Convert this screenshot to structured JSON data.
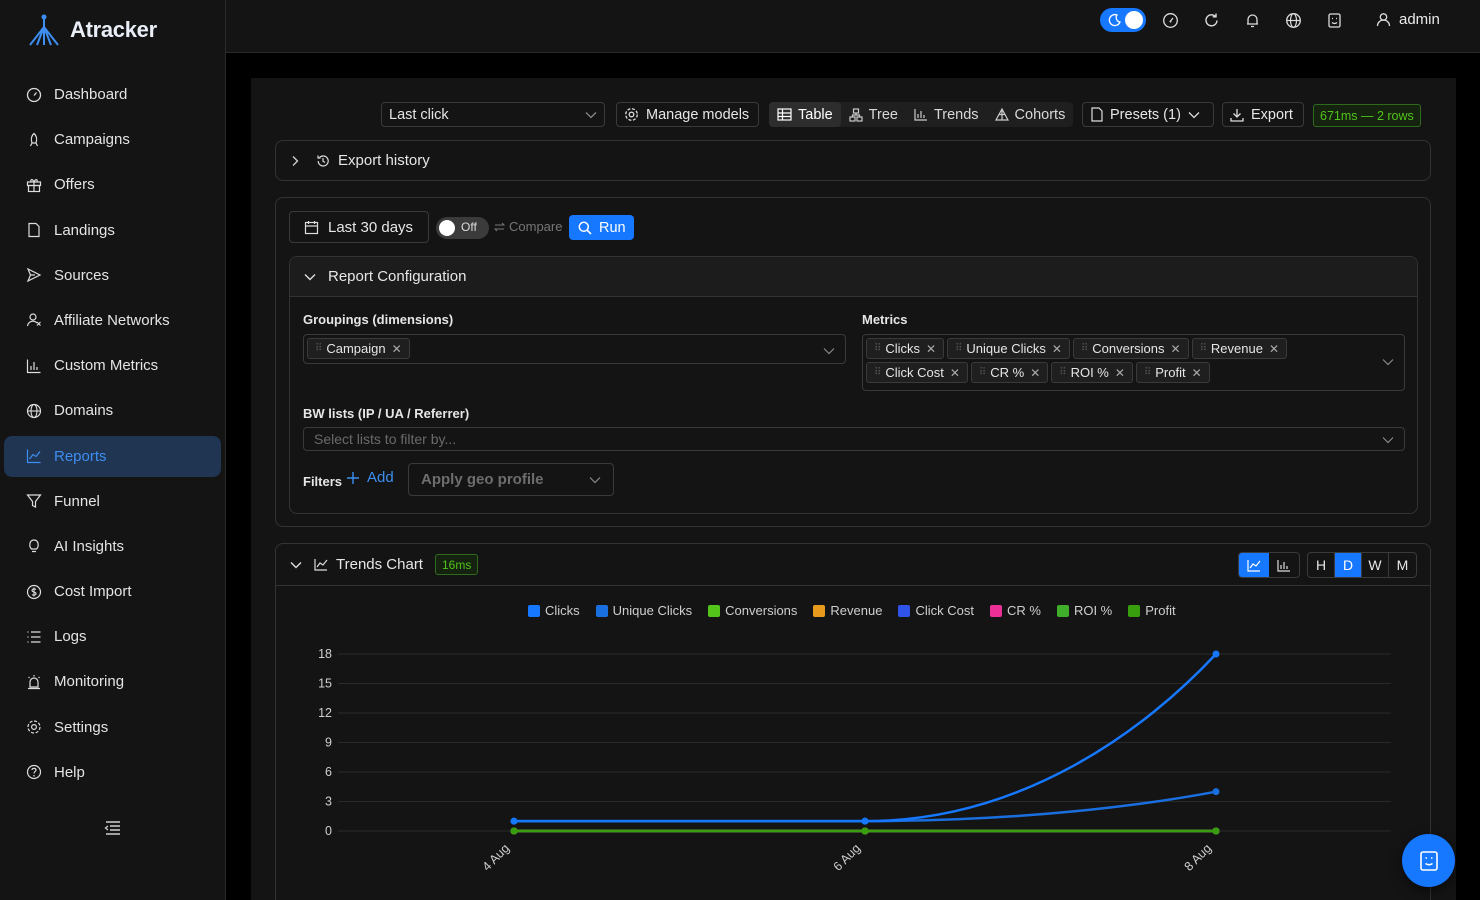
{
  "app": {
    "name": "Atracker"
  },
  "sidebar": {
    "items": [
      {
        "label": "Dashboard",
        "icon": "dashboard-icon"
      },
      {
        "label": "Campaigns",
        "icon": "rocket-icon"
      },
      {
        "label": "Offers",
        "icon": "gift-icon"
      },
      {
        "label": "Landings",
        "icon": "file-icon"
      },
      {
        "label": "Sources",
        "icon": "send-icon"
      },
      {
        "label": "Affiliate Networks",
        "icon": "user-network-icon"
      },
      {
        "label": "Custom Metrics",
        "icon": "bar-chart-icon"
      },
      {
        "label": "Domains",
        "icon": "globe-icon"
      },
      {
        "label": "Reports",
        "icon": "line-chart-icon",
        "active": true
      },
      {
        "label": "Funnel",
        "icon": "funnel-icon"
      },
      {
        "label": "AI Insights",
        "icon": "bulb-icon"
      },
      {
        "label": "Cost Import",
        "icon": "dollar-icon"
      },
      {
        "label": "Logs",
        "icon": "list-icon"
      },
      {
        "label": "Monitoring",
        "icon": "alarm-icon"
      },
      {
        "label": "Settings",
        "icon": "gear-icon"
      },
      {
        "label": "Help",
        "icon": "question-icon"
      }
    ]
  },
  "topbar": {
    "user": "admin"
  },
  "toolbar": {
    "attribution_model": "Last click",
    "manage_models": "Manage models",
    "views": [
      "Table",
      "Tree",
      "Trends",
      "Cohorts"
    ],
    "active_view": "Table",
    "presets": "Presets (1)",
    "export": "Export",
    "timing": "671ms — 2 rows"
  },
  "export_history": {
    "label": "Export history"
  },
  "report": {
    "date_range": "Last 30 days",
    "compare_toggle": "Off",
    "compare_label": "Compare",
    "run": "Run",
    "config_title": "Report Configuration",
    "groupings_label": "Groupings (dimensions)",
    "groupings": [
      "Campaign"
    ],
    "metrics_label": "Metrics",
    "metrics": [
      "Clicks",
      "Unique Clicks",
      "Conversions",
      "Revenue",
      "Click Cost",
      "CR %",
      "ROI %",
      "Profit"
    ],
    "bw_label": "BW lists (IP / UA / Referrer)",
    "bw_placeholder": "Select lists to filter by...",
    "filters_label": "Filters",
    "add_label": "Add",
    "geo_placeholder": "Apply geo profile"
  },
  "trends": {
    "title": "Trends Chart",
    "timing": "16ms",
    "granularity": [
      "H",
      "D",
      "W",
      "M"
    ],
    "active_granularity": "D"
  },
  "chart_data": {
    "type": "line",
    "x": [
      "4 Aug",
      "6 Aug",
      "8 Aug"
    ],
    "ylim": [
      0,
      18
    ],
    "yticks": [
      0,
      3,
      6,
      9,
      12,
      15,
      18
    ],
    "grid": true,
    "legend_position": "top",
    "series": [
      {
        "name": "Clicks",
        "color": "#1677ff",
        "values": [
          1,
          1,
          18
        ]
      },
      {
        "name": "Unique Clicks",
        "color": "#1a6fe0",
        "values": [
          1,
          1,
          4
        ]
      },
      {
        "name": "Conversions",
        "color": "#52c41a",
        "values": [
          0,
          0,
          0
        ]
      },
      {
        "name": "Revenue",
        "color": "#e89a1c",
        "values": [
          0,
          0,
          0
        ]
      },
      {
        "name": "Click Cost",
        "color": "#2f54eb",
        "values": [
          0,
          0,
          0
        ]
      },
      {
        "name": "CR %",
        "color": "#eb2f96",
        "values": [
          0,
          0,
          0
        ]
      },
      {
        "name": "ROI %",
        "color": "#3fae2a",
        "values": [
          0,
          0,
          0
        ]
      },
      {
        "name": "Profit",
        "color": "#389e0d",
        "values": [
          0,
          0,
          0
        ]
      }
    ]
  }
}
